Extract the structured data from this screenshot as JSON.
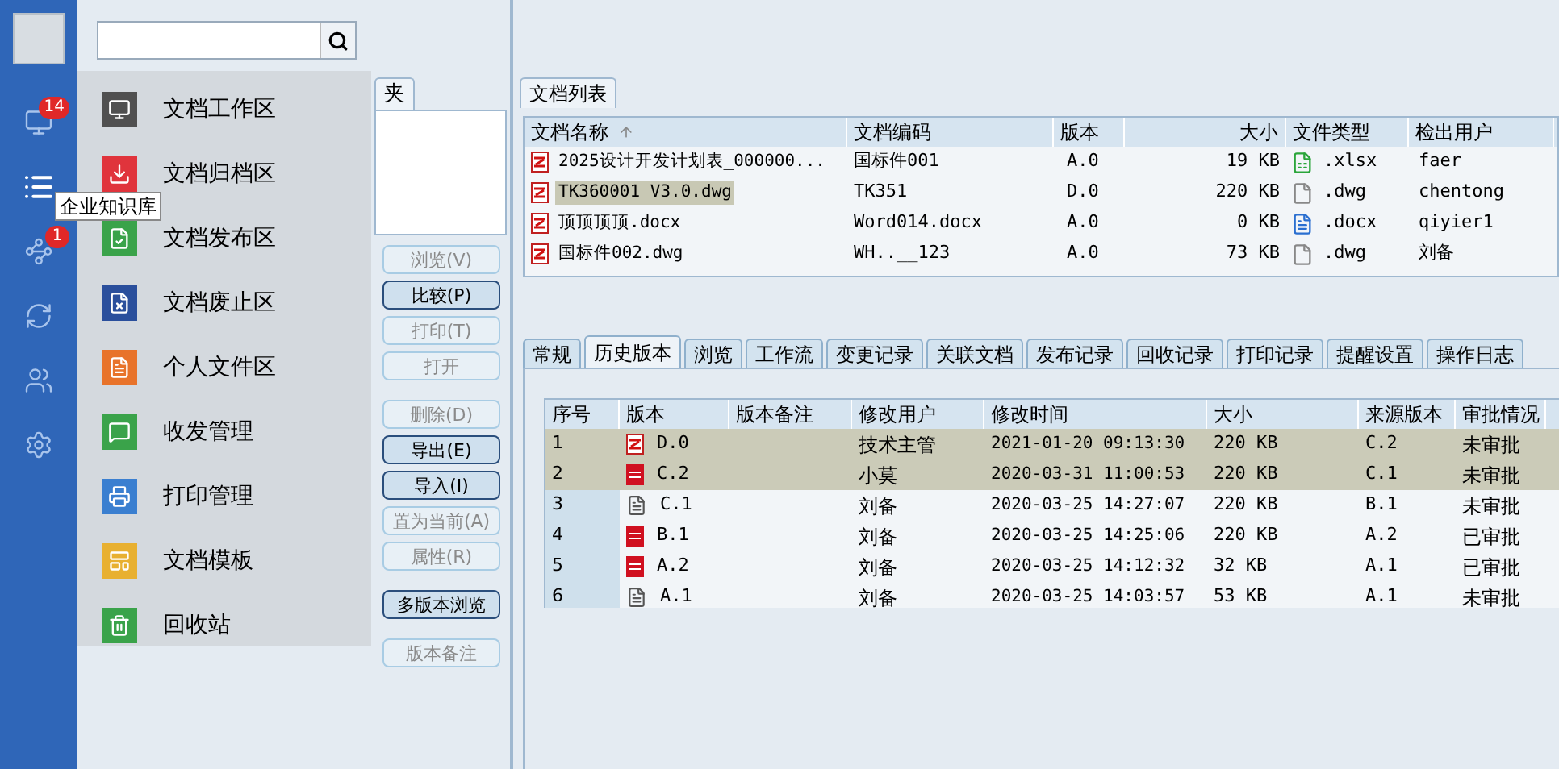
{
  "rail": {
    "items": [
      {
        "kind": "monitor",
        "badge": "14",
        "selected": false
      },
      {
        "kind": "list",
        "selected": true
      },
      {
        "kind": "graph",
        "badge": "1",
        "selected": false
      },
      {
        "kind": "sync",
        "selected": false
      },
      {
        "kind": "users",
        "selected": false
      },
      {
        "kind": "settings",
        "selected": false
      }
    ],
    "tooltip": "企业知识库"
  },
  "menu": [
    {
      "label": "文档工作区",
      "kind": "monitor",
      "color": "#505050"
    },
    {
      "label": "文档归档区",
      "kind": "archive",
      "color": "#e0343c"
    },
    {
      "label": "文档发布区",
      "kind": "publish",
      "color": "#3aa34a"
    },
    {
      "label": "文档废止区",
      "kind": "abolish",
      "color": "#2a4f9c"
    },
    {
      "label": "个人文件区",
      "kind": "personal",
      "color": "#e8732a"
    },
    {
      "label": "收发管理",
      "kind": "inbox",
      "color": "#3aa34a"
    },
    {
      "label": "打印管理",
      "kind": "print",
      "color": "#3a7fd0"
    },
    {
      "label": "文档模板",
      "kind": "template",
      "color": "#e8b030"
    },
    {
      "label": "回收站",
      "kind": "trash",
      "color": "#3aa34a"
    }
  ],
  "folder_tab": "夹",
  "actions": [
    {
      "label": "浏览(V)",
      "disabled": true
    },
    {
      "label": "比较(P)",
      "disabled": false
    },
    {
      "label": "打印(T)",
      "disabled": true
    },
    {
      "label": "打开",
      "disabled": true
    },
    {
      "label": "删除(D)",
      "disabled": true
    },
    {
      "label": "导出(E)",
      "disabled": false
    },
    {
      "label": "导入(I)",
      "disabled": false
    },
    {
      "label": "置为当前(A)",
      "disabled": true
    },
    {
      "label": "属性(R)",
      "disabled": true
    },
    {
      "label": "多版本浏览",
      "disabled": false
    },
    {
      "label": "版本备注",
      "disabled": true
    }
  ],
  "file_list": {
    "tab": "文档列表",
    "columns": [
      "文档名称",
      "文档编码",
      "版本",
      "大小",
      "文件类型",
      "检出用户"
    ],
    "rows": [
      {
        "name": "2025设计开发计划表_000000...",
        "code": "国标件001",
        "version": "A.0",
        "size": "19 KB",
        "kind": "xlsx",
        "type": ".xlsx",
        "user": "faer",
        "selected": false
      },
      {
        "name": "TK360001 V3.0.dwg",
        "code": "TK351",
        "version": "D.0",
        "size": "220 KB",
        "kind": "blank",
        "type": ".dwg",
        "user": "chentong",
        "selected": true
      },
      {
        "name": "顶顶顶顶.docx",
        "code": "Word014.docx",
        "version": "A.0",
        "size": "0 KB",
        "kind": "docx",
        "type": ".docx",
        "user": "qiyier1",
        "selected": false
      },
      {
        "name": "国标件002.dwg",
        "code": "WH..__123",
        "version": "A.0",
        "size": "73 KB",
        "kind": "blank",
        "type": ".dwg",
        "user": "刘备",
        "selected": false
      }
    ]
  },
  "detail_tabs": [
    {
      "label": "常规",
      "selected": false
    },
    {
      "label": "历史版本",
      "selected": true
    },
    {
      "label": "浏览",
      "selected": false
    },
    {
      "label": "工作流",
      "selected": false
    },
    {
      "label": "变更记录",
      "selected": false
    },
    {
      "label": "关联文档",
      "selected": false
    },
    {
      "label": "发布记录",
      "selected": false
    },
    {
      "label": "回收记录",
      "selected": false
    },
    {
      "label": "打印记录",
      "selected": false
    },
    {
      "label": "提醒设置",
      "selected": false
    },
    {
      "label": "操作日志",
      "selected": false
    }
  ],
  "history": {
    "columns": [
      "序号",
      "版本",
      "版本备注",
      "修改用户",
      "修改时间",
      "大小",
      "来源版本",
      "审批情况"
    ],
    "rows": [
      {
        "seq": "1",
        "kind": "drawing",
        "version": "D.0",
        "user": "技术主管",
        "time": "2021-01-20 09:13:30",
        "size": "220 KB",
        "source": "C.2",
        "approval": "未审批",
        "selected": true
      },
      {
        "seq": "2",
        "kind": "red",
        "version": "C.2",
        "user": "小莫",
        "time": "2020-03-31 11:00:53",
        "size": "220 KB",
        "source": "C.1",
        "approval": "未审批",
        "selected": true
      },
      {
        "seq": "3",
        "kind": "text",
        "version": "C.1",
        "user": "刘备",
        "time": "2020-03-25 14:27:07",
        "size": "220 KB",
        "source": "B.1",
        "approval": "未审批",
        "selected": false
      },
      {
        "seq": "4",
        "kind": "red",
        "version": "B.1",
        "user": "刘备",
        "time": "2020-03-25 14:25:06",
        "size": "220 KB",
        "source": "A.2",
        "approval": "已审批",
        "selected": false
      },
      {
        "seq": "5",
        "kind": "red",
        "version": "A.2",
        "user": "刘备",
        "time": "2020-03-25 14:12:32",
        "size": "32 KB",
        "source": "A.1",
        "approval": "已审批",
        "selected": false
      },
      {
        "seq": "6",
        "kind": "text",
        "version": "A.1",
        "user": "刘备",
        "time": "2020-03-25 14:03:57",
        "size": "53 KB",
        "source": "A.1",
        "approval": "未审批",
        "selected": false
      }
    ]
  }
}
